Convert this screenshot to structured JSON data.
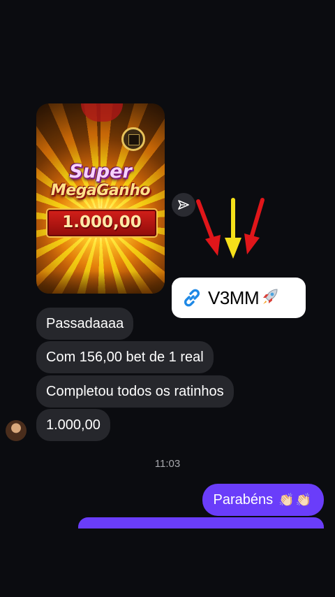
{
  "media": {
    "title_line1": "Super",
    "title_line2": "MegaGanho",
    "amount": "1.000,00"
  },
  "link_card": {
    "label": "V3MM",
    "icon": "link-icon",
    "trailing_icon": "rocket-icon"
  },
  "messages": [
    {
      "text": "Passadaaaa"
    },
    {
      "text": "Com 156,00 bet de 1 real"
    },
    {
      "text": "Completou todos os ratinhos"
    },
    {
      "text": "1.000,00"
    }
  ],
  "timestamp": "11:03",
  "sent_message": {
    "text": "Parabéns",
    "emoji": "👏🏻👏🏻"
  },
  "colors": {
    "background": "#0b0c10",
    "received_bubble": "#26272c",
    "sent_bubble": "#6a3dfa",
    "arrow_red": "#e0161a",
    "arrow_yellow": "#f5e01a"
  }
}
